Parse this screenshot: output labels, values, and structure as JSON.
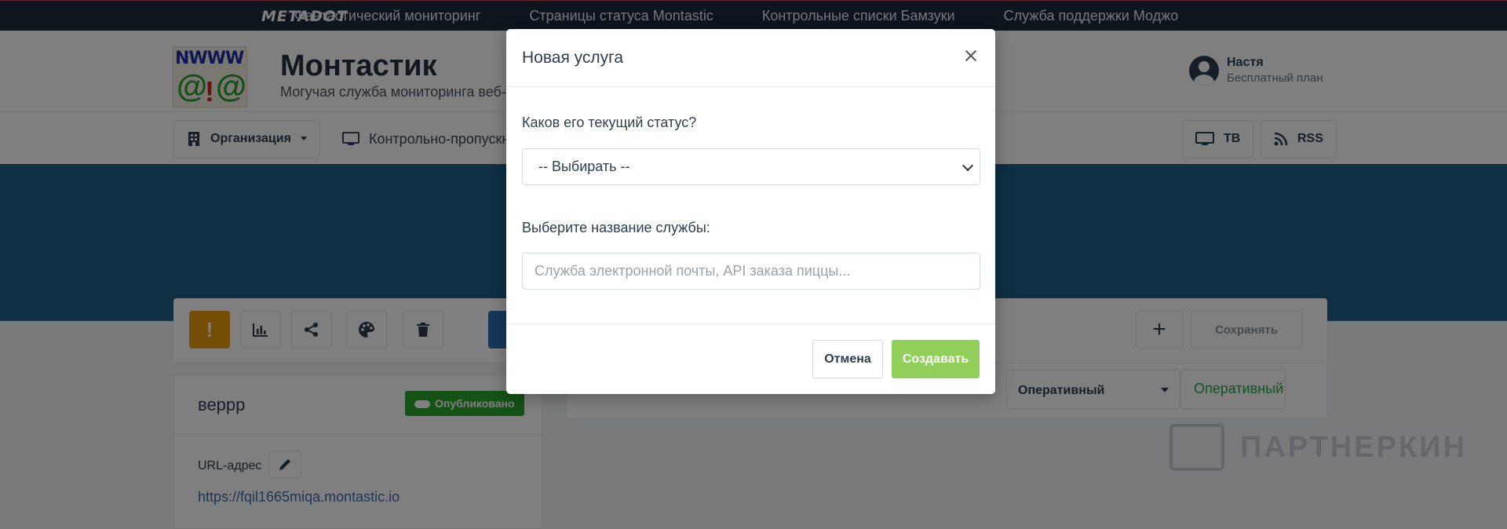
{
  "topbar": {
    "brand": "METADOT",
    "links": [
      "Фантастический мониторинг",
      "Страницы статуса Montastic",
      "Контрольные списки Бамзуки",
      "Служба поддержки Моджо"
    ]
  },
  "header": {
    "title": "Монтастик",
    "subtitle": "Могучая служба мониторинга веб-сайтов",
    "user_name": "Настя",
    "user_plan": "Бесплатный план"
  },
  "subnav": {
    "org_label": "Организация",
    "checkpoint_label": "Контрольно-пропускной пункт",
    "tv_label": "ТВ",
    "rss_label": "RSS"
  },
  "toolbar": {
    "warn_glyph": "!",
    "plus_glyph": "+",
    "save_label": "Сохранять"
  },
  "card": {
    "name": "веррр",
    "published_label": "Опубликовано",
    "url_label": "URL-адрес",
    "url": "https://fqil1665miqa.montastic.io"
  },
  "service_row": {
    "status_select": "Оперативный",
    "status_text": "Оперативный"
  },
  "watermark": "ПАРТНЕРКИН",
  "modal": {
    "title": "Новая услуга",
    "status_question": "Каков его текущий статус?",
    "status_placeholder": "-- Выбирать --",
    "name_label": "Выберите название службы:",
    "name_placeholder": "Служба электронной почты, API заказа пиццы...",
    "name_value": "",
    "cancel_label": "Отмена",
    "create_label": "Создавать"
  },
  "colors": {
    "topbar_bg": "#1b2b3a",
    "banner_bg": "#1f5f86",
    "create_btn": "#92cf5a",
    "published_badge": "#2aa52a",
    "warning_btn": "#e89a0c",
    "operational_text": "#27a844"
  },
  "icons": [
    "building-icon",
    "monitor-icon",
    "tv-icon",
    "rss-icon",
    "user-avatar-icon",
    "chart-icon",
    "share-icon",
    "palette-icon",
    "trash-icon",
    "pencil-icon",
    "close-icon",
    "chevron-down-icon",
    "toggle-icon"
  ]
}
